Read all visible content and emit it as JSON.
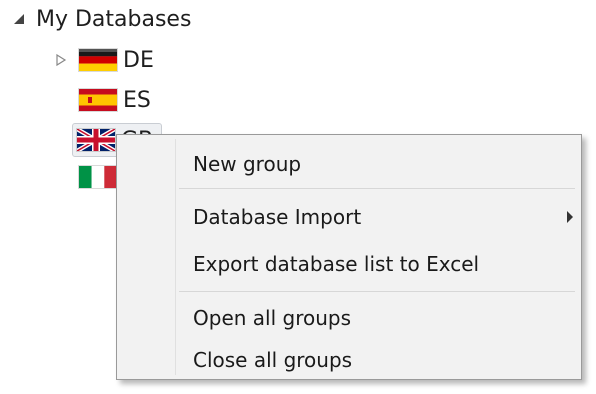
{
  "tree": {
    "root": {
      "label": "My Databases",
      "icon": "expanded-triangle-icon"
    },
    "nodes": [
      {
        "id": "de",
        "label": "DE",
        "flag": "germany-flag-icon",
        "expander": "collapsed-triangle-icon"
      },
      {
        "id": "es",
        "label": "ES",
        "flag": "spain-flag-icon"
      },
      {
        "id": "gb",
        "label": "GB",
        "flag": "uk-flag-icon"
      },
      {
        "id": "it",
        "label": "",
        "flag": "italy-flag-icon"
      }
    ]
  },
  "context_menu": {
    "items": [
      {
        "label": "New group"
      },
      {
        "label": "Database Import",
        "submenu": true
      },
      {
        "label": "Export database list to Excel"
      },
      {
        "label": "Open all groups"
      },
      {
        "label": "Close all groups"
      }
    ]
  },
  "colors": {
    "menu_background": "#f2f2f2",
    "menu_border": "#9a9a9a",
    "selection_background": "#eef0f3"
  }
}
